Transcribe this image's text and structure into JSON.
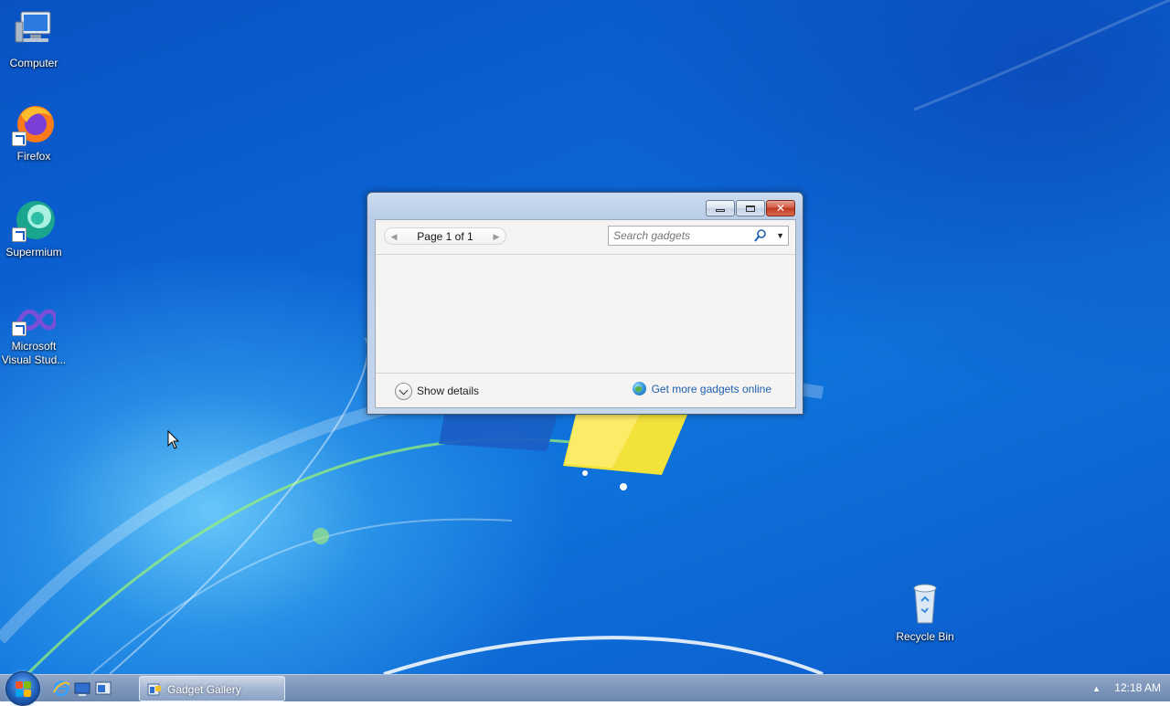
{
  "desktop": {
    "icons": [
      {
        "label": "Computer",
        "icon": "computer-icon",
        "shortcut": false
      },
      {
        "label": "Firefox",
        "icon": "firefox-icon",
        "shortcut": true
      },
      {
        "label": "Supermium",
        "icon": "supermium-icon",
        "shortcut": true
      },
      {
        "label": "Microsoft Visual Stud...",
        "icon": "visual-studio-icon",
        "shortcut": true
      },
      {
        "label": "Recycle Bin",
        "icon": "recycle-bin-icon",
        "shortcut": false
      }
    ]
  },
  "gallery": {
    "pager_label": "Page 1 of 1",
    "search_placeholder": "Search gadgets",
    "show_details_label": "Show details",
    "get_more_label": "Get more gadgets online"
  },
  "taskbar": {
    "task_item_label": "Gadget Gallery",
    "clock": "12:18 AM"
  },
  "colors": {
    "link": "#1e5fb0",
    "close_button": "#c0391f",
    "taskbar": "#7f97bb"
  }
}
